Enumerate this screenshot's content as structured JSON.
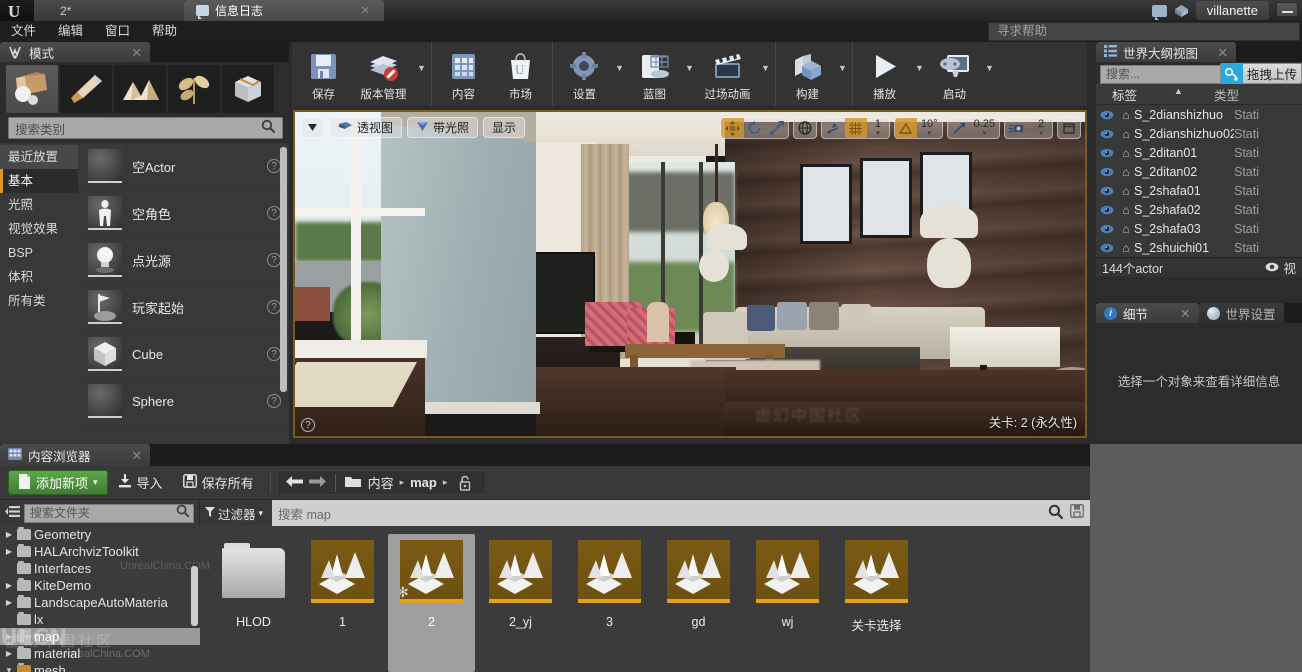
{
  "titlebar": {
    "logo": "ue-logo",
    "project_tab": "2*",
    "log_tab": "信息日志",
    "close_glyph": "✕",
    "user": "villanette",
    "chat_icon": "chat-bubble-icon",
    "launcher_icon": "launcher-icon",
    "minimize_icon": "minimize-icon"
  },
  "menubar": {
    "items": [
      "文件",
      "编辑",
      "窗口",
      "帮助"
    ],
    "help_placeholder": "寻求帮助"
  },
  "modes": {
    "tab_label": "模式",
    "tab_close": "✕",
    "mode_buttons": [
      {
        "name": "place-mode",
        "icon": "place-cube-icon",
        "selected": true
      },
      {
        "name": "paint-mode",
        "icon": "paintbrush-icon",
        "selected": false
      },
      {
        "name": "landscape-mode",
        "icon": "landscape-mountain-icon",
        "selected": false
      },
      {
        "name": "foliage-mode",
        "icon": "foliage-leaf-icon",
        "selected": false
      },
      {
        "name": "geometry-edit-mode",
        "icon": "geometry-box-icon",
        "selected": false
      }
    ],
    "search_placeholder": "搜索类别",
    "categories": [
      {
        "label": "最近放置",
        "selected": false,
        "highlight": true
      },
      {
        "label": "基本",
        "selected": true,
        "highlight": false
      },
      {
        "label": "光照",
        "selected": false,
        "highlight": false
      },
      {
        "label": "视觉效果",
        "selected": false,
        "highlight": false
      },
      {
        "label": "BSP",
        "selected": false,
        "highlight": false
      },
      {
        "label": "体积",
        "selected": false,
        "highlight": false
      },
      {
        "label": "所有类",
        "selected": false,
        "highlight": false
      }
    ],
    "items": [
      {
        "label": "空Actor",
        "icon": "sphere-thumb-icon"
      },
      {
        "label": "空角色",
        "icon": "character-thumb-icon"
      },
      {
        "label": "点光源",
        "icon": "pointlight-thumb-icon"
      },
      {
        "label": "玩家起始",
        "icon": "playerstart-thumb-icon"
      },
      {
        "label": "Cube",
        "icon": "cube-thumb-icon"
      },
      {
        "label": "Sphere",
        "icon": "sphere2-thumb-icon"
      }
    ],
    "help_glyph": "?"
  },
  "toolbar": {
    "groups": [
      {
        "buttons": [
          {
            "label": "保存",
            "icon": "save-floppy-icon",
            "caret": false
          },
          {
            "label": "版本管理",
            "icon": "source-control-icon",
            "caret": true
          }
        ]
      },
      {
        "buttons": [
          {
            "label": "内容",
            "icon": "content-grid-icon",
            "caret": false
          },
          {
            "label": "市场",
            "icon": "marketplace-bag-icon",
            "caret": false
          }
        ]
      },
      {
        "buttons": [
          {
            "label": "设置",
            "icon": "settings-gear-icon",
            "caret": true
          },
          {
            "label": "蓝图",
            "icon": "blueprint-icon",
            "caret": true
          },
          {
            "label": "过场动画",
            "icon": "cinematic-clapper-icon",
            "caret": true
          }
        ]
      },
      {
        "buttons": [
          {
            "label": "构建",
            "icon": "build-cube-icon",
            "caret": true
          }
        ]
      },
      {
        "buttons": [
          {
            "label": "播放",
            "icon": "play-triangle-icon",
            "caret": true
          },
          {
            "label": "启动",
            "icon": "launch-device-icon",
            "caret": true
          }
        ]
      }
    ]
  },
  "viewport": {
    "left_chips": [
      {
        "name": "viewport-options",
        "label": "",
        "icon": "chevron-down-icon"
      },
      {
        "name": "view-perspective",
        "label": "透视图",
        "icon": "camera-icon"
      },
      {
        "name": "view-lit",
        "label": "带光照",
        "icon": "lit-sphere-icon"
      },
      {
        "name": "view-show",
        "label": "显示",
        "icon": ""
      }
    ],
    "right_controls": [
      {
        "name": "translate-mode",
        "icon": "move-gizmo-icon",
        "active": true
      },
      {
        "name": "rotate-mode",
        "icon": "rotate-gizmo-icon",
        "active": false
      },
      {
        "name": "scale-mode",
        "icon": "scale-gizmo-icon",
        "active": false
      },
      {
        "name": "world-coords",
        "icon": "globe-icon",
        "active": false
      },
      {
        "name": "surface-snap",
        "icon": "surface-snap-icon",
        "active": false
      },
      {
        "name": "grid-snap-toggle",
        "icon": "grid-icon",
        "active": true
      },
      {
        "name": "grid-snap-value",
        "label": "1",
        "active": false
      },
      {
        "name": "rotation-snap-toggle",
        "icon": "angle-icon",
        "active": true
      },
      {
        "name": "rotation-snap-value",
        "label": "10°",
        "active": false
      },
      {
        "name": "scale-snap-toggle",
        "icon": "scale-snap-icon",
        "active": false
      },
      {
        "name": "scale-snap-value",
        "label": "0.25",
        "active": false
      },
      {
        "name": "camera-speed-toggle",
        "icon": "camera-speed-icon",
        "active": false
      },
      {
        "name": "camera-speed-value",
        "label": "2",
        "active": false
      },
      {
        "name": "maximize-viewport",
        "icon": "maximize-icon",
        "active": false
      }
    ],
    "status": "关卡:  2 (永久性)",
    "help_glyph": "?",
    "scene_watermark": "虚幻中国社区"
  },
  "outliner": {
    "tab_label": "世界大纲视图",
    "tab_icon": "outliner-icon",
    "tab_close": "✕",
    "search_placeholder": "搜索...",
    "drag_upload_label": "拖拽上传",
    "drag_upload_icon": "cloud-upload-icon",
    "columns": {
      "label": "标签",
      "type": "类型"
    },
    "sort_arrow": "▲",
    "rows": [
      {
        "name": "S_2dianshizhuo",
        "type": "Stati",
        "visible": true,
        "icon": "static-mesh-icon"
      },
      {
        "name": "S_2dianshizhuo02",
        "type": "Stati",
        "visible": true,
        "icon": "static-mesh-icon"
      },
      {
        "name": "S_2ditan01",
        "type": "Stati",
        "visible": true,
        "icon": "static-mesh-icon"
      },
      {
        "name": "S_2ditan02",
        "type": "Stati",
        "visible": true,
        "icon": "static-mesh-icon"
      },
      {
        "name": "S_2shafa01",
        "type": "Stati",
        "visible": true,
        "icon": "static-mesh-icon"
      },
      {
        "name": "S_2shafa02",
        "type": "Stati",
        "visible": true,
        "icon": "static-mesh-icon"
      },
      {
        "name": "S_2shafa03",
        "type": "Stati",
        "visible": true,
        "icon": "static-mesh-icon"
      },
      {
        "name": "S_2shuichi01",
        "type": "Stati",
        "visible": true,
        "icon": "static-mesh-icon"
      }
    ],
    "footer_count": "144个actor",
    "footer_eye_icon": "eye-icon",
    "footer_extra": "视"
  },
  "details": {
    "tab_label": "细节",
    "tab_icon": "info-icon",
    "tab_close": "✕",
    "world_tab_label": "世界设置",
    "world_tab_icon": "globe-icon",
    "empty_message": "选择一个对象来查看详细信息"
  },
  "content_browser": {
    "tab_label": "内容浏览器",
    "tab_icon": "content-browser-icon",
    "tab_close": "✕",
    "add_new_label": "添加新项",
    "add_new_icon": "add-file-icon",
    "add_new_caret": "▾",
    "import_label": "导入",
    "import_icon": "import-icon",
    "save_all_label": "保存所有",
    "save_all_icon": "save-icon",
    "back_icon": "arrow-left-icon",
    "forward_icon": "arrow-right-icon",
    "folder_icon": "folder-open-icon",
    "breadcrumbs": [
      "内容",
      "map"
    ],
    "crumb_sep": "▸",
    "lock_icon": "unlock-icon",
    "folder_search_placeholder": "搜索文件夹",
    "folder_search_icon": "search-icon",
    "filter_label": "过滤器",
    "filter_icon": "funnel-icon",
    "filter_caret": "▾",
    "asset_search_placeholder": "搜索 map",
    "asset_search_icon": "search-icon",
    "asset_save_icon": "save-small-icon",
    "tree_nodes": [
      {
        "label": "Geometry",
        "expandable": true,
        "selected": false,
        "open": false
      },
      {
        "label": "HALArchvizToolkit",
        "expandable": true,
        "selected": false,
        "open": false
      },
      {
        "label": "Interfaces",
        "expandable": false,
        "selected": false,
        "open": false
      },
      {
        "label": "KiteDemo",
        "expandable": true,
        "selected": false,
        "open": false
      },
      {
        "label": "LandscapeAutoMateria",
        "expandable": true,
        "selected": false,
        "open": false
      },
      {
        "label": "lx",
        "expandable": false,
        "selected": false,
        "open": false
      },
      {
        "label": "map",
        "expandable": true,
        "selected": true,
        "open": true
      },
      {
        "label": "material",
        "expandable": true,
        "selected": false,
        "open": false
      },
      {
        "label": "mesh",
        "expandable": true,
        "selected": false,
        "open": true
      }
    ],
    "tiles": [
      {
        "name": "HLOD",
        "kind": "folder",
        "selected": false,
        "dirty": false
      },
      {
        "name": "1",
        "kind": "level",
        "selected": false,
        "dirty": false
      },
      {
        "name": "2",
        "kind": "level",
        "selected": true,
        "dirty": true
      },
      {
        "name": "2_yj",
        "kind": "level",
        "selected": false,
        "dirty": false
      },
      {
        "name": "3",
        "kind": "level",
        "selected": false,
        "dirty": false
      },
      {
        "name": "gd",
        "kind": "level",
        "selected": false,
        "dirty": false
      },
      {
        "name": "wj",
        "kind": "level",
        "selected": false,
        "dirty": false
      },
      {
        "name": "关卡选择",
        "kind": "level",
        "selected": false,
        "dirty": false
      }
    ],
    "dirty_glyph": "✻"
  },
  "watermark": {
    "brand": "UECN",
    "line1": "虚幻中国社区",
    "line2": "UnrealChina.COM"
  },
  "colors": {
    "accent_orange": "#d79a26",
    "green_button": "#4f9440",
    "panel_bg": "#2c2c2c",
    "list_bg": "#383838",
    "tab_bg": "#444444",
    "viewport_border": "#7a5a1e",
    "upload_blue": "#29a8e0"
  }
}
